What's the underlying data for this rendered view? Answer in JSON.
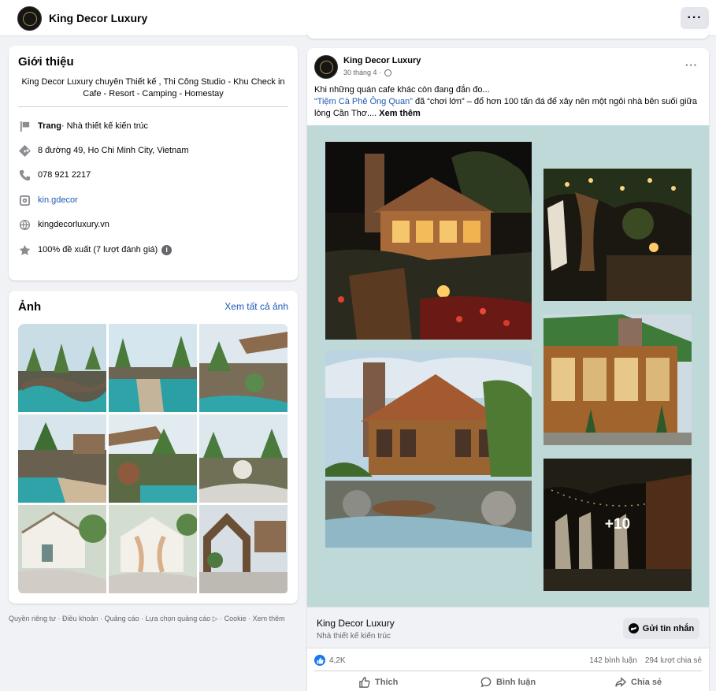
{
  "header": {
    "page_name": "King Decor Luxury",
    "more_label": "···"
  },
  "intro": {
    "title": "Giới thiệu",
    "bio": "King Decor Luxury chuyên Thiết kế , Thi Công Studio - Khu Check in Cafe - Resort - Camping - Homestay",
    "category_prefix": "Trang",
    "category": " · Nhà thiết kế kiến trúc",
    "address": "8 đường 49, Ho Chi Minh City, Vietnam",
    "phone": "078 921 2217",
    "instagram": "kin.gdecor",
    "website": "kingdecorluxury.vn",
    "rating": "100% đề xuất (7 lượt đánh giá)",
    "info_badge": "i"
  },
  "photos": {
    "title": "Ảnh",
    "see_all": "Xem tất cả ảnh"
  },
  "footer": {
    "links": "Quyền riêng tư · Điều khoản · Quảng cáo · Lựa chọn quảng cáo ▷ · Cookie · Xem thêm"
  },
  "post": {
    "author": "King Decor Luxury",
    "date": "30 tháng 4 ·",
    "more_label": "···",
    "text_line1": "Khi những quán cafe khác còn đang đắn đo...",
    "text_link": "“Tiệm Cà Phê Ông Quan”",
    "text_rest": " đã “chơi lớn” – đổ hơn 100 tấn đá để xây nên một ngôi nhà bên suối giữa lòng Cần Thơ.... ",
    "see_more": "Xem thêm",
    "extra_photos": "+10",
    "cta_name": "King Decor Luxury",
    "cta_sub": "Nhà thiết kế kiến trúc",
    "cta_button": "Gửi tin nhắn",
    "reaction_count": "4,2K",
    "comments": "142 bình luận",
    "shares": "294 lượt chia sẻ",
    "action_like": "Thích",
    "action_comment": "Bình luận",
    "action_share": "Chia sẻ"
  },
  "colors": {
    "link": "#1c5ab8",
    "like_blue": "#1877f2",
    "media_background": "#bfd8d8"
  }
}
